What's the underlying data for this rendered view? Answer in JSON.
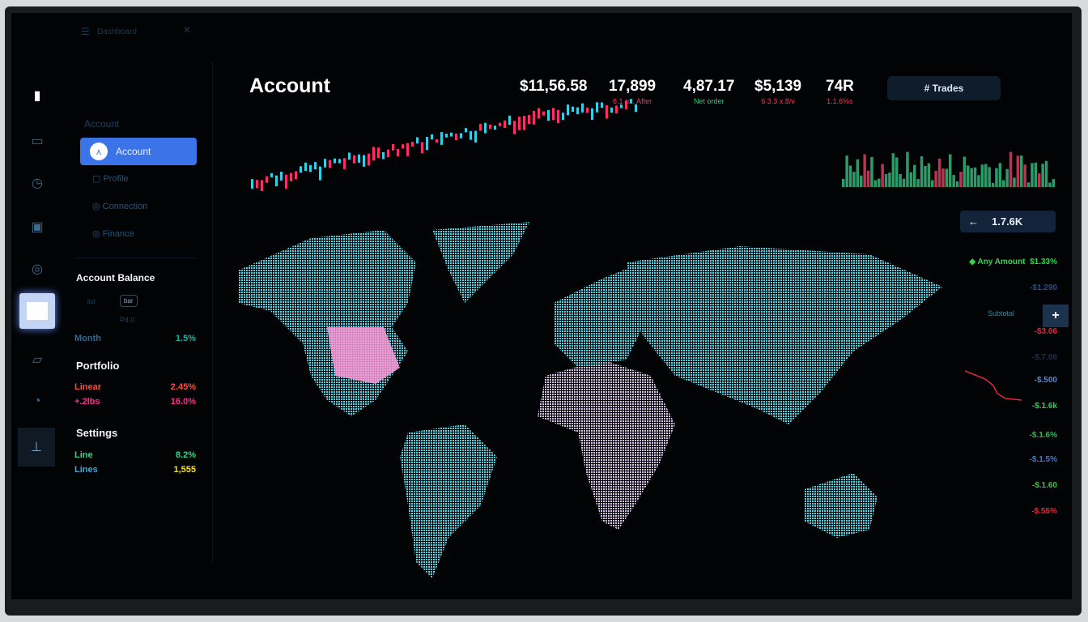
{
  "topbar": {
    "menu_label": "Dashboard",
    "close_icon": "close-icon"
  },
  "sidebar": {
    "section_label": "Account",
    "active_item": "Account",
    "items": [
      {
        "label": "Profile",
        "icon": "profile-icon"
      },
      {
        "label": "Connection",
        "icon": "connection-icon"
      },
      {
        "label": "Finance",
        "icon": "finance-icon"
      }
    ],
    "balance": {
      "title": "Account Balance",
      "tab1": "list",
      "tab2": "bar",
      "value": "P4.0",
      "row_label": "Month",
      "row_value": "1.5%"
    },
    "portfolio": {
      "title": "Portfolio",
      "rows": [
        {
          "label": "Linear",
          "value": "2.45%",
          "color": "#ff4a3a"
        },
        {
          "label": "+.2lbs",
          "value": "16.0%",
          "color": "#ff2d8a"
        }
      ]
    },
    "settings": {
      "title": "Settings",
      "rows": [
        {
          "label": "Line",
          "value": "8.2%",
          "color": "#2fd88a"
        },
        {
          "label": "Lines",
          "value": "1,555",
          "color": "#f5e030"
        }
      ]
    }
  },
  "header": {
    "title": "Account",
    "stats": [
      {
        "value": "$11,56.58",
        "sub": "",
        "color": "#fff"
      },
      {
        "value": "17,899",
        "sub": "6.1 px. After",
        "color": "#ff3366"
      },
      {
        "value": "4,87.17",
        "sub": "Net order",
        "color": "#1ed07a"
      },
      {
        "value": "$5,139",
        "sub": "6 3.3 x.8/v",
        "color": "#ff3355"
      },
      {
        "value": "74R",
        "sub": "1.1.6%s",
        "color": "#ff3355"
      }
    ],
    "trades_button": "# Trades"
  },
  "right": {
    "chip": "1.7.6K",
    "entry_label": "Any Amount",
    "entry_value": "$1.33%",
    "add_label": "Subtotal",
    "values": [
      {
        "v": "-$1.290",
        "c": "#2b4c80"
      },
      {
        "v": "-$3.06",
        "c": "#e0283a"
      },
      {
        "v": "-$.7.06",
        "c": "#1d3050"
      },
      {
        "v": "-$.500",
        "c": "#5a86d0"
      },
      {
        "v": "-$.1.6k",
        "c": "#2fcf5a"
      },
      {
        "v": "-$.1.6%",
        "c": "#2fb85a"
      },
      {
        "v": "-$.1.5%",
        "c": "#4a78c8"
      },
      {
        "v": "-$.1.60",
        "c": "#3ec040"
      },
      {
        "v": "-$.55%",
        "c": "#e0283a"
      }
    ]
  },
  "colors": {
    "accent": "#3b74e8",
    "map": "#4fd6e6",
    "highlight": "#ff8fd0",
    "africa": "#c9b8d8"
  }
}
